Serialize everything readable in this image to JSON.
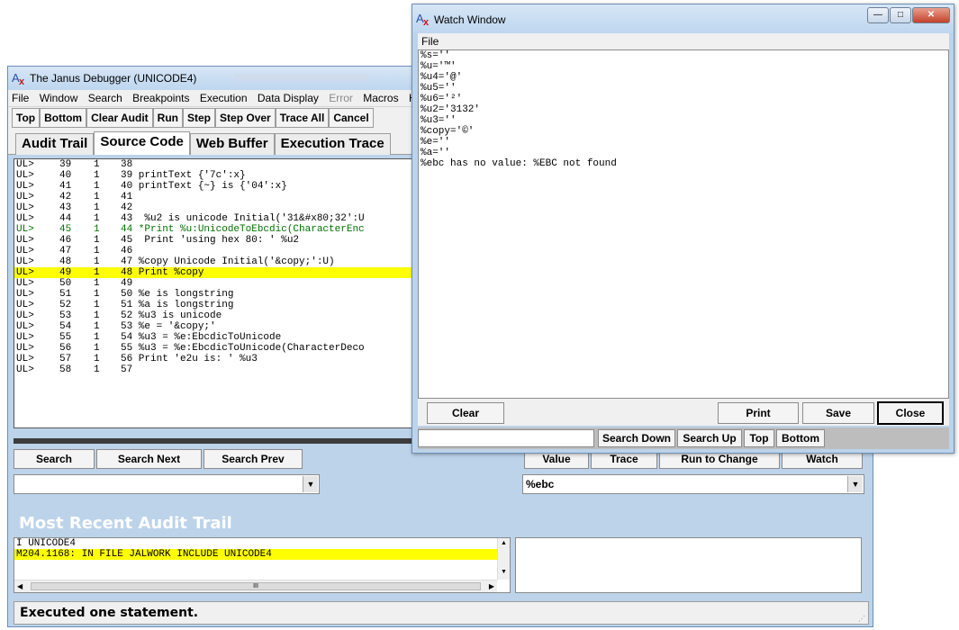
{
  "main_window": {
    "title": "The Janus Debugger (UNICODE4)",
    "menu": [
      {
        "label": "File",
        "disabled": false
      },
      {
        "label": "Window",
        "disabled": false
      },
      {
        "label": "Search",
        "disabled": false
      },
      {
        "label": "Breakpoints",
        "disabled": false
      },
      {
        "label": "Execution",
        "disabled": false
      },
      {
        "label": "Data Display",
        "disabled": false
      },
      {
        "label": "Error",
        "disabled": true
      },
      {
        "label": "Macros",
        "disabled": false
      },
      {
        "label": "H",
        "disabled": false
      }
    ],
    "toolbar": [
      "Top",
      "Bottom",
      "Clear Audit",
      "Run",
      "Step",
      "Step Over",
      "Trace All",
      "Cancel"
    ],
    "tabs": [
      {
        "label": "Audit Trail",
        "selected": false
      },
      {
        "label": "Source Code",
        "selected": true
      },
      {
        "label": "Web Buffer",
        "selected": false
      },
      {
        "label": "Execution Trace",
        "selected": false
      }
    ],
    "code_lines": [
      {
        "p": "UL>",
        "n": "39",
        "d": "1",
        "t": "38",
        "highlight": false,
        "green": false
      },
      {
        "p": "UL>",
        "n": "40",
        "d": "1",
        "t": "39 printText {'7c':x}",
        "highlight": false,
        "green": false
      },
      {
        "p": "UL>",
        "n": "41",
        "d": "1",
        "t": "40 printText {~} is {'04':x}",
        "highlight": false,
        "green": false
      },
      {
        "p": "UL>",
        "n": "42",
        "d": "1",
        "t": "41",
        "highlight": false,
        "green": false
      },
      {
        "p": "UL>",
        "n": "43",
        "d": "1",
        "t": "42",
        "highlight": false,
        "green": false
      },
      {
        "p": "UL>",
        "n": "44",
        "d": "1",
        "t": "43  %u2 is unicode Initial('31&#x80;32':U",
        "highlight": false,
        "green": false
      },
      {
        "p": "UL>",
        "n": "45",
        "d": "1",
        "t": "44 *Print %u:UnicodeToEbcdic(CharacterEnc",
        "highlight": false,
        "green": true
      },
      {
        "p": "UL>",
        "n": "46",
        "d": "1",
        "t": "45  Print 'using hex 80: ' %u2",
        "highlight": false,
        "green": false
      },
      {
        "p": "UL>",
        "n": "47",
        "d": "1",
        "t": "46",
        "highlight": false,
        "green": false
      },
      {
        "p": "UL>",
        "n": "48",
        "d": "1",
        "t": "47 %copy Unicode Initial('&copy;':U)",
        "highlight": false,
        "green": false
      },
      {
        "p": "UL>",
        "n": "49",
        "d": "1",
        "t": "48 Print %copy",
        "highlight": true,
        "green": false
      },
      {
        "p": "UL>",
        "n": "50",
        "d": "1",
        "t": "49",
        "highlight": false,
        "green": false
      },
      {
        "p": "UL>",
        "n": "51",
        "d": "1",
        "t": "50 %e is longstring",
        "highlight": false,
        "green": false
      },
      {
        "p": "UL>",
        "n": "52",
        "d": "1",
        "t": "51 %a is longstring",
        "highlight": false,
        "green": false
      },
      {
        "p": "UL>",
        "n": "53",
        "d": "1",
        "t": "52 %u3 is unicode",
        "highlight": false,
        "green": false
      },
      {
        "p": "UL>",
        "n": "54",
        "d": "1",
        "t": "53 %e = '&copy;'",
        "highlight": false,
        "green": false
      },
      {
        "p": "UL>",
        "n": "55",
        "d": "1",
        "t": "54 %u3 = %e:EbcdicToUnicode",
        "highlight": false,
        "green": false
      },
      {
        "p": "UL>",
        "n": "56",
        "d": "1",
        "t": "55 %u3 = %e:EbcdicToUnicode(CharacterDeco",
        "highlight": false,
        "green": false
      },
      {
        "p": "UL>",
        "n": "57",
        "d": "1",
        "t": "56 Print 'e2u is: ' %u3",
        "highlight": false,
        "green": false
      },
      {
        "p": "UL>",
        "n": "58",
        "d": "1",
        "t": "57",
        "highlight": false,
        "green": false
      }
    ],
    "search_buttons": {
      "search": "Search",
      "next": "Search Next",
      "prev": "Search Prev"
    },
    "search_combo_value": "",
    "watch_buttons": {
      "value": "Value",
      "trace": "Trace",
      "run_to_change": "Run to Change",
      "watch": "Watch"
    },
    "watch_combo_value": "%ebc",
    "audit_heading": "Most Recent Audit Trail",
    "audit_lines": [
      {
        "text": "I UNICODE4",
        "highlight": false
      },
      {
        "text": "M204.1168: IN FILE JALWORK INCLUDE UNICODE4",
        "highlight": true
      }
    ],
    "scroll_mark": "III",
    "status": "Executed one statement.",
    "colors": {
      "highlight": "#ffff00",
      "panel": "#bcd3ea",
      "comment_green": "#007000"
    }
  },
  "watch_window": {
    "title": "Watch Window",
    "menu": [
      "File"
    ],
    "lines": [
      "%s=''",
      "%u='™'",
      "%u4='@'",
      "%u5=''",
      "%u6='²'",
      "%u2='3132'",
      "%u3=''",
      "%copy='©'",
      "%e=''",
      "%a=''",
      "%ebc has no value: %EBC not found"
    ],
    "buttons": {
      "clear": "Clear",
      "print": "Print",
      "save": "Save",
      "close": "Close"
    },
    "bottom_buttons": [
      "Search Down",
      "Search Up",
      "Top",
      "Bottom"
    ],
    "search_value": ""
  }
}
